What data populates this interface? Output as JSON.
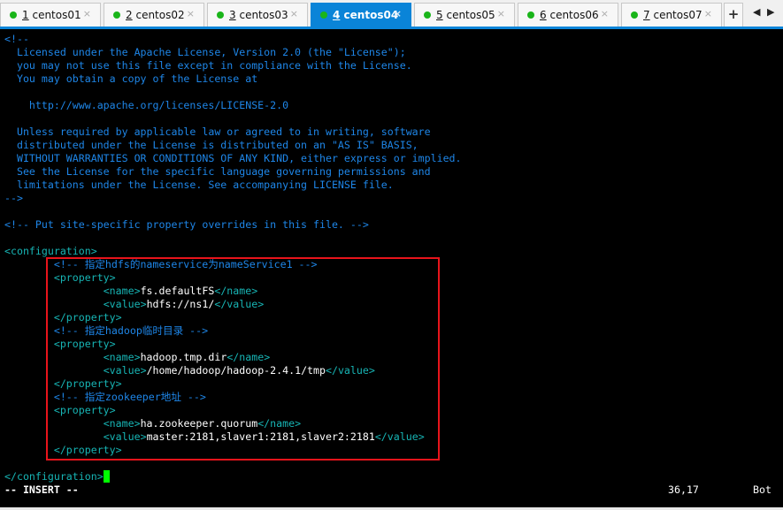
{
  "tabs": [
    {
      "num": "1",
      "name": "centos01",
      "active": false
    },
    {
      "num": "2",
      "name": "centos02",
      "active": false
    },
    {
      "num": "3",
      "name": "centos03",
      "active": false
    },
    {
      "num": "4",
      "name": "centos04",
      "active": true
    },
    {
      "num": "5",
      "name": "centos05",
      "active": false
    },
    {
      "num": "6",
      "name": "centos06",
      "active": false
    },
    {
      "num": "7",
      "name": "centos07",
      "active": false
    }
  ],
  "tabbar": {
    "close": "×",
    "new_tab": "+",
    "prev": "◀",
    "next": "▶"
  },
  "colors": {
    "comment": "#1e86e8",
    "tag": "#17b5b5",
    "text": "#ffffff",
    "accent": "#0a84d8",
    "highlight_box": "#e8141b",
    "cursor": "#00ff00"
  },
  "editor": {
    "lines": [
      [
        [
          "c",
          "<!--"
        ]
      ],
      [
        [
          "c",
          "  Licensed under the Apache License, Version 2.0 (the \"License\");"
        ]
      ],
      [
        [
          "c",
          "  you may not use this file except in compliance with the License."
        ]
      ],
      [
        [
          "c",
          "  You may obtain a copy of the License at"
        ]
      ],
      [],
      [
        [
          "c",
          "    http://www.apache.org/licenses/LICENSE-2.0"
        ]
      ],
      [],
      [
        [
          "c",
          "  Unless required by applicable law or agreed to in writing, software"
        ]
      ],
      [
        [
          "c",
          "  distributed under the License is distributed on an \"AS IS\" BASIS,"
        ]
      ],
      [
        [
          "c",
          "  WITHOUT WARRANTIES OR CONDITIONS OF ANY KIND, either express or implied."
        ]
      ],
      [
        [
          "c",
          "  See the License for the specific language governing permissions and"
        ]
      ],
      [
        [
          "c",
          "  limitations under the License. See accompanying LICENSE file."
        ]
      ],
      [
        [
          "c",
          "-->"
        ]
      ],
      [],
      [
        [
          "c",
          "<!-- Put site-specific property overrides in this file. -->"
        ]
      ],
      [],
      [
        [
          "g",
          "<configuration>"
        ]
      ],
      [
        [
          "w",
          "        "
        ],
        [
          "c",
          "<!-- 指定hdfs的nameservice为nameService1 -->"
        ]
      ],
      [
        [
          "w",
          "        "
        ],
        [
          "g",
          "<property>"
        ]
      ],
      [
        [
          "w",
          "                "
        ],
        [
          "g",
          "<name>"
        ],
        [
          "w",
          "fs.defaultFS"
        ],
        [
          "g",
          "</name>"
        ]
      ],
      [
        [
          "w",
          "                "
        ],
        [
          "g",
          "<value>"
        ],
        [
          "w",
          "hdfs://ns1/"
        ],
        [
          "g",
          "</value>"
        ]
      ],
      [
        [
          "w",
          "        "
        ],
        [
          "g",
          "</property>"
        ]
      ],
      [
        [
          "w",
          "        "
        ],
        [
          "c",
          "<!-- 指定hadoop临时目录 -->"
        ]
      ],
      [
        [
          "w",
          "        "
        ],
        [
          "g",
          "<property>"
        ]
      ],
      [
        [
          "w",
          "                "
        ],
        [
          "g",
          "<name>"
        ],
        [
          "w",
          "hadoop.tmp.dir"
        ],
        [
          "g",
          "</name>"
        ]
      ],
      [
        [
          "w",
          "                "
        ],
        [
          "g",
          "<value>"
        ],
        [
          "w",
          "/home/hadoop/hadoop-2.4.1/tmp"
        ],
        [
          "g",
          "</value>"
        ]
      ],
      [
        [
          "w",
          "        "
        ],
        [
          "g",
          "</property>"
        ]
      ],
      [
        [
          "w",
          "        "
        ],
        [
          "c",
          "<!-- 指定zookeeper地址 -->"
        ]
      ],
      [
        [
          "w",
          "        "
        ],
        [
          "g",
          "<property>"
        ]
      ],
      [
        [
          "w",
          "                "
        ],
        [
          "g",
          "<name>"
        ],
        [
          "w",
          "ha.zookeeper.quorum"
        ],
        [
          "g",
          "</name>"
        ]
      ],
      [
        [
          "w",
          "                "
        ],
        [
          "g",
          "<value>"
        ],
        [
          "w",
          "master:2181,slaver1:2181,slaver2:2181"
        ],
        [
          "g",
          "</value>"
        ]
      ],
      [
        [
          "w",
          "        "
        ],
        [
          "g",
          "</property>"
        ]
      ],
      [],
      [
        [
          "g",
          "</configuration>"
        ],
        [
          "cursor",
          ""
        ]
      ]
    ]
  },
  "status": {
    "mode": "-- INSERT --",
    "position": "36,17",
    "scroll": "Bot"
  }
}
